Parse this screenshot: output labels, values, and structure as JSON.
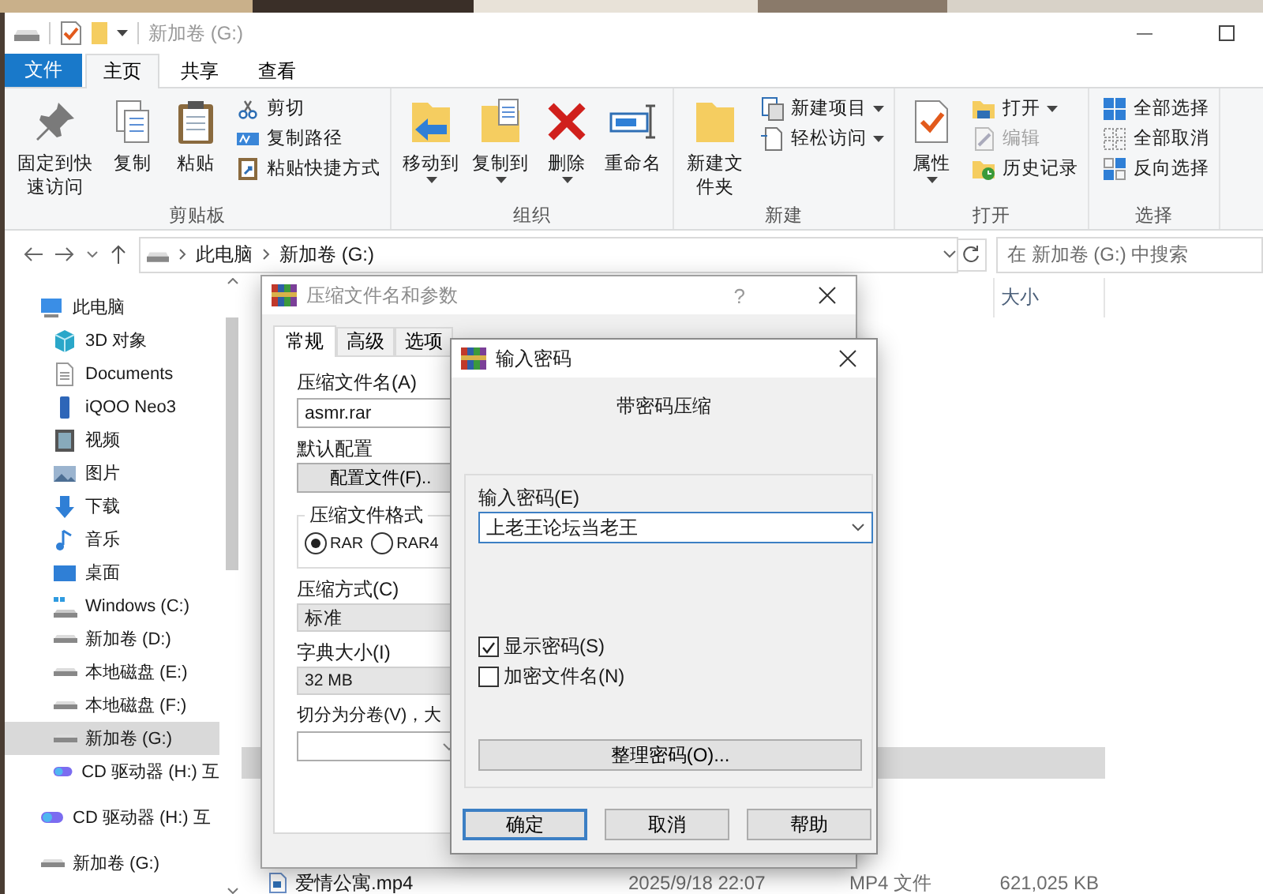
{
  "explorer": {
    "title": "新加卷 (G:)",
    "file_tab": "文件",
    "tabs": [
      {
        "label": "主页",
        "selected": true
      },
      {
        "label": "共享",
        "selected": false
      },
      {
        "label": "查看",
        "selected": false
      }
    ],
    "ribbon_groups": [
      {
        "label": "剪贴板",
        "large": [
          {
            "label": "固定到快速访问",
            "dropdown": false
          },
          {
            "label": "复制",
            "dropdown": false
          },
          {
            "label": "粘贴",
            "dropdown": false
          }
        ],
        "small": [
          {
            "label": "剪切",
            "dropdown": false,
            "disabled": false
          },
          {
            "label": "复制路径",
            "dropdown": false,
            "disabled": false
          },
          {
            "label": "粘贴快捷方式",
            "dropdown": false,
            "disabled": false
          }
        ]
      },
      {
        "label": "组织",
        "large": [
          {
            "label": "移动到",
            "dropdown": true
          },
          {
            "label": "复制到",
            "dropdown": true
          },
          {
            "label": "删除",
            "dropdown": true
          },
          {
            "label": "重命名",
            "dropdown": false
          }
        ]
      },
      {
        "label": "新建",
        "large": [
          {
            "label": "新建文件夹",
            "dropdown": false
          }
        ],
        "small": [
          {
            "label": "新建项目",
            "dropdown": true,
            "disabled": false
          },
          {
            "label": "轻松访问",
            "dropdown": true,
            "disabled": false
          }
        ]
      },
      {
        "label": "打开",
        "large": [
          {
            "label": "属性",
            "dropdown": true
          }
        ],
        "small": [
          {
            "label": "打开",
            "dropdown": true,
            "disabled": false
          },
          {
            "label": "编辑",
            "dropdown": false,
            "disabled": true
          },
          {
            "label": "历史记录",
            "dropdown": false,
            "disabled": false
          }
        ]
      },
      {
        "label": "选择",
        "small": [
          {
            "label": "全部选择",
            "dropdown": false,
            "disabled": false
          },
          {
            "label": "全部取消",
            "dropdown": false,
            "disabled": false
          },
          {
            "label": "反向选择",
            "dropdown": false,
            "disabled": false
          }
        ]
      }
    ],
    "address": {
      "crumbs": [
        "此电脑",
        "新加卷 (G:)"
      ]
    },
    "search": {
      "placeholder": "在 新加卷 (G:) 中搜索"
    },
    "nav_tree": [
      {
        "label": "此电脑",
        "selected": false,
        "children": [
          {
            "label": "3D 对象",
            "selected": false
          },
          {
            "label": "Documents",
            "selected": false
          },
          {
            "label": "iQOO Neo3",
            "selected": false
          },
          {
            "label": "视频",
            "selected": false
          },
          {
            "label": "图片",
            "selected": false
          },
          {
            "label": "下载",
            "selected": false
          },
          {
            "label": "音乐",
            "selected": false
          },
          {
            "label": "桌面",
            "selected": false
          },
          {
            "label": "Windows (C:)",
            "selected": false
          },
          {
            "label": "新加卷 (D:)",
            "selected": false
          },
          {
            "label": "本地磁盘 (E:)",
            "selected": false
          },
          {
            "label": "本地磁盘 (F:)",
            "selected": false
          },
          {
            "label": "新加卷 (G:)",
            "selected": true
          },
          {
            "label": "CD 驱动器 (H:) 互",
            "selected": false
          }
        ]
      },
      {
        "label": "CD 驱动器 (H:) 互",
        "selected": false
      },
      {
        "label": "新加卷 (G:)",
        "selected": false
      }
    ],
    "list_header": {
      "size": "大小"
    },
    "files": [
      {
        "selected": true
      },
      {
        "name": "爱情公寓.mp4",
        "date": "2025/9/18 22:07",
        "type": "MP4 文件",
        "size": "621,025 KB",
        "selected": false
      }
    ]
  },
  "archive_dialog": {
    "title": "压缩文件名和参数",
    "help": "?",
    "tabs": [
      {
        "label": "常规",
        "selected": true
      },
      {
        "label": "高级",
        "selected": false
      },
      {
        "label": "选项",
        "selected": false
      }
    ],
    "archive_name": {
      "label": "压缩文件名(A)",
      "value": "asmr.rar"
    },
    "profile": {
      "label": "默认配置",
      "button": "配置文件(F).."
    },
    "format": {
      "label": "压缩文件格式",
      "options": [
        {
          "label": "RAR",
          "selected": true
        },
        {
          "label": "RAR4",
          "selected": false
        }
      ]
    },
    "method": {
      "label": "压缩方式(C)",
      "value": "标准"
    },
    "dictionary": {
      "label": "字典大小(I)",
      "value": "32 MB"
    },
    "split": {
      "label": "切分为分卷(V)，大"
    }
  },
  "password_dialog": {
    "title": "输入密码",
    "heading": "带密码压缩",
    "password": {
      "label": "输入密码(E)",
      "value": "上老王论坛当老王"
    },
    "options": [
      {
        "label": "显示密码(S)",
        "checked": true
      },
      {
        "label": "加密文件名(N)",
        "checked": false
      }
    ],
    "organize_button": "整理密码(O)...",
    "buttons": [
      {
        "label": "确定",
        "default": true
      },
      {
        "label": "取消",
        "default": false
      },
      {
        "label": "帮助",
        "default": false
      }
    ]
  }
}
